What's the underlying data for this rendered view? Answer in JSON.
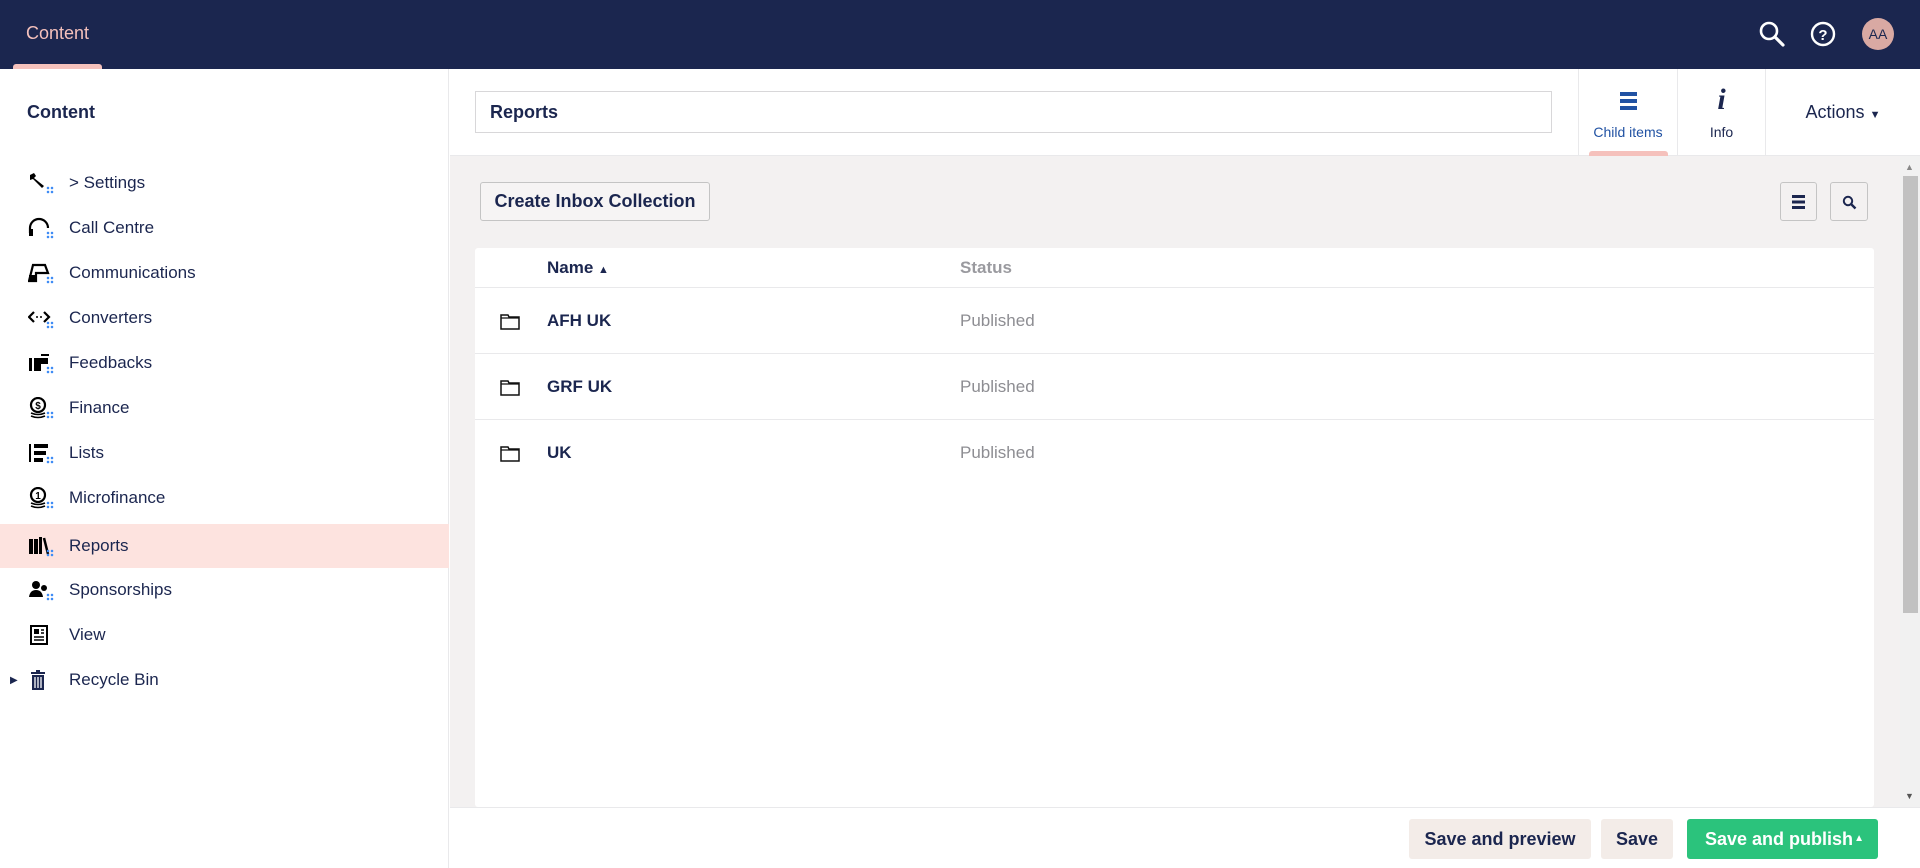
{
  "header": {
    "section_tab": "Content",
    "avatar_initials": "AA",
    "icons": [
      "search-icon",
      "help-icon"
    ]
  },
  "sidebar": {
    "title": "Content",
    "items": [
      {
        "label": "> Settings",
        "icon": "wrench-icon"
      },
      {
        "label": "Call Centre",
        "icon": "headset-icon"
      },
      {
        "label": "Communications",
        "icon": "inbox-icon"
      },
      {
        "label": "Converters",
        "icon": "code-arrows-icon"
      },
      {
        "label": "Feedbacks",
        "icon": "feedback-icon"
      },
      {
        "label": "Finance",
        "icon": "coins-icon"
      },
      {
        "label": "Lists",
        "icon": "ordered-list-icon"
      },
      {
        "label": "Microfinance",
        "icon": "coin-icon"
      },
      {
        "label": "Reports",
        "icon": "books-icon",
        "active": true
      },
      {
        "label": "Sponsorships",
        "icon": "users-icon"
      },
      {
        "label": "View",
        "icon": "newspaper-icon"
      },
      {
        "label": "Recycle Bin",
        "icon": "trash-icon"
      }
    ]
  },
  "editor": {
    "name_value": "Reports",
    "tabs": [
      {
        "label": "Child items",
        "active": true
      },
      {
        "label": "Info"
      }
    ],
    "actions_label": "Actions"
  },
  "listview": {
    "create_button": "Create Inbox Collection",
    "columns": {
      "name": "Name",
      "status": "Status"
    },
    "rows": [
      {
        "name": "AFH UK",
        "status": "Published"
      },
      {
        "name": "GRF UK",
        "status": "Published"
      },
      {
        "name": "UK",
        "status": "Published"
      }
    ]
  },
  "footer": {
    "save_preview": "Save and preview",
    "save": "Save",
    "save_publish": "Save and publish"
  },
  "colors": {
    "header": "#1b264f",
    "accent": "#f5c1bc",
    "active_item": "#fde3df",
    "publish": "#2bc37c"
  }
}
